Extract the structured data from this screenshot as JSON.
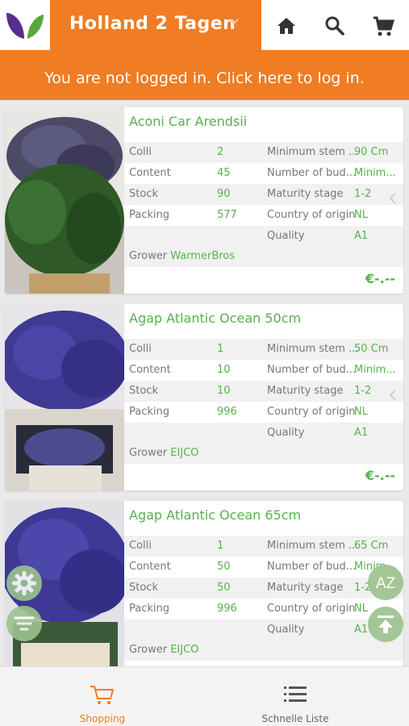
{
  "header": {
    "title": "Holland 2 Tagen",
    "icons": [
      "logo-leaves",
      "chevron-down-icon",
      "home-icon",
      "search-icon",
      "cart-icon"
    ]
  },
  "login_banner": "You are not logged in. Click here to log in.",
  "labels": {
    "colli": "Colli",
    "content": "Content",
    "stock": "Stock",
    "packing": "Packing",
    "min_stem": "Minimum stem ...",
    "num_buds": "Number of bud...",
    "maturity": "Maturity stage",
    "country": "Country of origin",
    "quality": "Quality",
    "grower": "Grower"
  },
  "products": [
    {
      "name": "Aconi Car Arendsii",
      "colli": "2",
      "content": "45",
      "stock": "90",
      "packing": "577",
      "min_stem": "90 Cm",
      "num_buds": "Minim...",
      "maturity": "1-2",
      "country": "NL",
      "quality": "A1",
      "grower": "WarmerBros",
      "price": "€-.--"
    },
    {
      "name": "Agap Atlantic Ocean 50cm",
      "colli": "1",
      "content": "10",
      "stock": "10",
      "packing": "996",
      "min_stem": "50 Cm",
      "num_buds": "Minim...",
      "maturity": "1-2",
      "country": "NL",
      "quality": "A1",
      "grower": "EIJCO",
      "price": "€-.--"
    },
    {
      "name": "Agap Atlantic Ocean 65cm",
      "colli": "1",
      "content": "50",
      "stock": "50",
      "packing": "996",
      "min_stem": "65 Cm",
      "num_buds": "Minim...",
      "maturity": "1-2",
      "country": "NL",
      "quality": "A1",
      "grower": "EIJCO",
      "price": "€-.--"
    }
  ],
  "fabs": {
    "left": [
      "settings-gear-icon",
      "filter-icon"
    ],
    "right": [
      "sort-az-icon",
      "scroll-top-icon"
    ],
    "sort_label": "AZ"
  },
  "tabs": [
    {
      "label": "Shopping",
      "icon": "cart-icon",
      "active": true
    },
    {
      "label": "Schnelle Liste",
      "icon": "list-icon",
      "active": false
    }
  ],
  "colors": {
    "accent": "#f07c23",
    "green": "#54b34a",
    "purple": "#5b2d8e",
    "leaf_green": "#5aa63a"
  }
}
